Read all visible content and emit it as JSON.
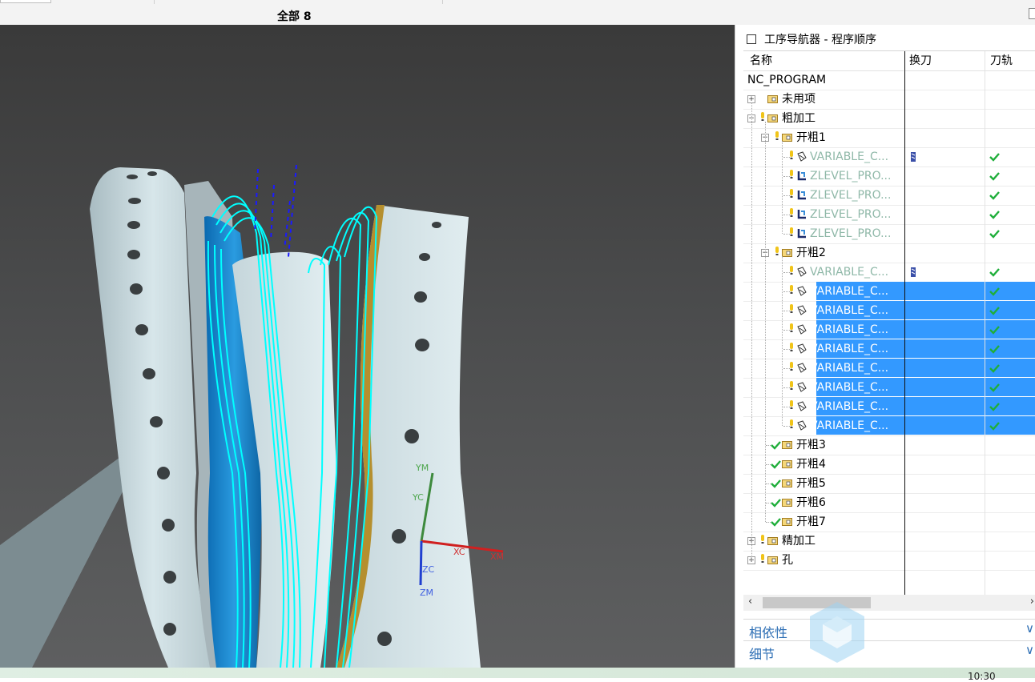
{
  "toolbar": {
    "filter_label": "全部 8"
  },
  "navigator": {
    "title": "工序导航器 - 程序顺序",
    "columns": [
      "名称",
      "换刀",
      "刀轨"
    ],
    "rows": [
      {
        "label": "NC_PROGRAM",
        "level": 0,
        "kind": "root",
        "state": "normal"
      },
      {
        "label": "未用项",
        "level": 1,
        "kind": "folder",
        "expander": "+",
        "state": "normal"
      },
      {
        "label": "粗加工",
        "level": 1,
        "kind": "folder",
        "expander": "−",
        "status": "bulb",
        "state": "normal"
      },
      {
        "label": "开粗1",
        "level": 2,
        "kind": "folder",
        "expander": "−",
        "status": "bulb",
        "state": "normal"
      },
      {
        "label": "VARIABLE_C...",
        "level": 3,
        "kind": "op-var",
        "status": "bulb",
        "tool": true,
        "path": "check",
        "state": "gray"
      },
      {
        "label": "ZLEVEL_PRO...",
        "level": 3,
        "kind": "op-z",
        "status": "bulb",
        "tool": false,
        "path": "check",
        "state": "gray"
      },
      {
        "label": "ZLEVEL_PRO...",
        "level": 3,
        "kind": "op-z",
        "status": "bulb",
        "tool": false,
        "path": "check",
        "state": "gray"
      },
      {
        "label": "ZLEVEL_PRO...",
        "level": 3,
        "kind": "op-z",
        "status": "bulb",
        "tool": false,
        "path": "check",
        "state": "gray"
      },
      {
        "label": "ZLEVEL_PRO...",
        "level": 3,
        "kind": "op-z",
        "status": "bulb",
        "tool": false,
        "path": "check",
        "state": "gray"
      },
      {
        "label": "开粗2",
        "level": 2,
        "kind": "folder",
        "expander": "−",
        "status": "bulb",
        "state": "normal"
      },
      {
        "label": "VARIABLE_C...",
        "level": 3,
        "kind": "op-var",
        "status": "bulb",
        "tool": true,
        "path": "check",
        "state": "gray"
      },
      {
        "label": "VARIABLE_C...",
        "level": 3,
        "kind": "op-var",
        "status": "bulb",
        "tool": false,
        "path": "check",
        "state": "selected"
      },
      {
        "label": "VARIABLE_C...",
        "level": 3,
        "kind": "op-var",
        "status": "bulb",
        "tool": false,
        "path": "check",
        "state": "selected"
      },
      {
        "label": "VARIABLE_C...",
        "level": 3,
        "kind": "op-var",
        "status": "bulb",
        "tool": false,
        "path": "check",
        "state": "selected"
      },
      {
        "label": "VARIABLE_C...",
        "level": 3,
        "kind": "op-var",
        "status": "bulb",
        "tool": false,
        "path": "check",
        "state": "selected"
      },
      {
        "label": "VARIABLE_C...",
        "level": 3,
        "kind": "op-var",
        "status": "bulb",
        "tool": false,
        "path": "check",
        "state": "selected"
      },
      {
        "label": "VARIABLE_C...",
        "level": 3,
        "kind": "op-var",
        "status": "bulb",
        "tool": false,
        "path": "check",
        "state": "selected"
      },
      {
        "label": "VARIABLE_C...",
        "level": 3,
        "kind": "op-var",
        "status": "bulb",
        "tool": false,
        "path": "check",
        "state": "selected"
      },
      {
        "label": "VARIABLE_C...",
        "level": 3,
        "kind": "op-var",
        "status": "bulb",
        "tool": false,
        "path": "check",
        "state": "selected"
      },
      {
        "label": "开粗3",
        "level": 2,
        "kind": "folder",
        "status": "check",
        "state": "normal"
      },
      {
        "label": "开粗4",
        "level": 2,
        "kind": "folder",
        "status": "check",
        "state": "normal"
      },
      {
        "label": "开粗5",
        "level": 2,
        "kind": "folder",
        "status": "check",
        "state": "normal"
      },
      {
        "label": "开粗6",
        "level": 2,
        "kind": "folder",
        "status": "check",
        "state": "normal"
      },
      {
        "label": "开粗7",
        "level": 2,
        "kind": "folder",
        "status": "check",
        "state": "normal"
      },
      {
        "label": "精加工",
        "level": 1,
        "kind": "folder",
        "expander": "+",
        "status": "bulb",
        "state": "normal"
      },
      {
        "label": "孔",
        "level": 1,
        "kind": "folder",
        "expander": "+",
        "status": "bulb",
        "state": "normal"
      }
    ]
  },
  "panels": [
    {
      "label": "相依性"
    },
    {
      "label": "细节"
    }
  ],
  "viewport": {
    "axes": [
      "YM",
      "YC",
      "XC",
      "XM",
      "ZC",
      "ZM"
    ]
  },
  "status": {
    "clock": "10:30"
  },
  "colors": {
    "selection": "#3399ff",
    "toolpath": "#00ffff",
    "check": "#1fae3a",
    "bulb": "#f0c419",
    "panel_text": "#2e6fb5"
  }
}
